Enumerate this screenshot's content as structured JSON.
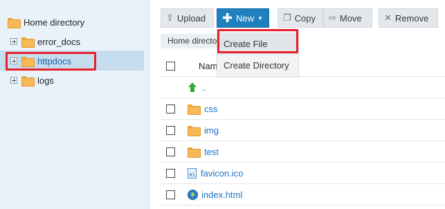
{
  "tree": {
    "root_label": "Home directory",
    "children": [
      {
        "label": "error_docs"
      },
      {
        "label": "httpdocs"
      },
      {
        "label": "logs"
      }
    ]
  },
  "toolbar": {
    "upload_label": "Upload",
    "new_label": "New",
    "copy_label": "Copy",
    "move_label": "Move",
    "remove_label": "Remove"
  },
  "breadcrumb": "Home directo",
  "new_menu": {
    "items": [
      "Create File",
      "Create Directory"
    ]
  },
  "file_list": {
    "header_name": "Name",
    "rows": [
      {
        "name": "..",
        "type": "parent"
      },
      {
        "name": "css",
        "type": "folder"
      },
      {
        "name": "img",
        "type": "folder"
      },
      {
        "name": "test",
        "type": "folder"
      },
      {
        "name": "favicon.ico",
        "type": "ico-file"
      },
      {
        "name": "index.html",
        "type": "html-file"
      }
    ]
  },
  "colors": {
    "accent": "#1f7fbf",
    "highlight": "#e8202a",
    "folder": "#f7b955",
    "link": "#1a73c4",
    "tree_bg": "#e9f2fa"
  }
}
